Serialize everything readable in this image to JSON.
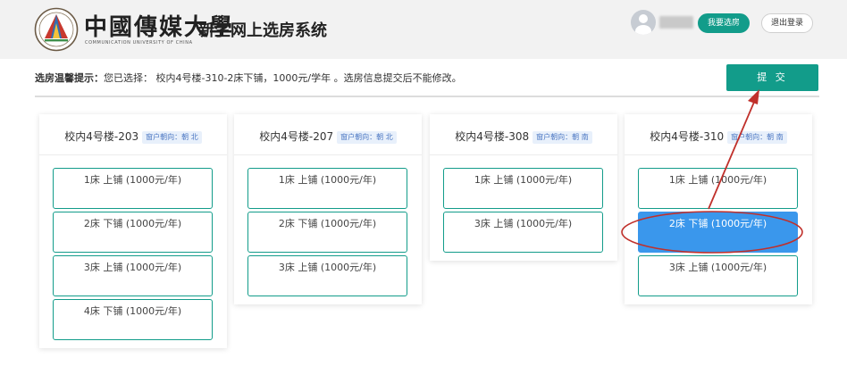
{
  "header": {
    "university_cn": "中國傳媒大學",
    "university_en": "COMMUNICATION UNIVERSITY OF CHINA",
    "system_title": "新生网上选房系统",
    "my_room_label": "我要选房",
    "logout_label": "退出登录"
  },
  "notice": {
    "label": "选房温馨提示：",
    "text": "您已选择： 校内4号楼-310-2床下铺，1000元/学年 。选房信息提交后不能修改。"
  },
  "submit_label": "提 交",
  "rooms": [
    {
      "title": "校内4号楼-203",
      "orientation": "窗户朝向：朝 北",
      "beds": [
        {
          "label": "1床 上铺 (1000元/年)"
        },
        {
          "label": "2床 下铺 (1000元/年)"
        },
        {
          "label": "3床 上铺 (1000元/年)"
        },
        {
          "label": "4床 下铺 (1000元/年)"
        }
      ]
    },
    {
      "title": "校内4号楼-207",
      "orientation": "窗户朝向：朝 北",
      "beds": [
        {
          "label": "1床 上铺 (1000元/年)"
        },
        {
          "label": "2床 下铺 (1000元/年)"
        },
        {
          "label": "3床 上铺 (1000元/年)"
        }
      ]
    },
    {
      "title": "校内4号楼-308",
      "orientation": "窗户朝向：朝 南",
      "beds": [
        {
          "label": "1床 上铺 (1000元/年)"
        },
        {
          "label": "3床 上铺 (1000元/年)"
        }
      ]
    },
    {
      "title": "校内4号楼-310",
      "orientation": "窗户朝向：朝 南",
      "beds": [
        {
          "label": "1床 上铺 (1000元/年)"
        },
        {
          "label": "2床 下铺 (1000元/年)",
          "selected": true
        },
        {
          "label": "3床 上铺 (1000元/年)"
        }
      ]
    }
  ],
  "colors": {
    "accent": "#129c8a",
    "selected": "#3a97ec",
    "annotation": "#c0302b"
  }
}
